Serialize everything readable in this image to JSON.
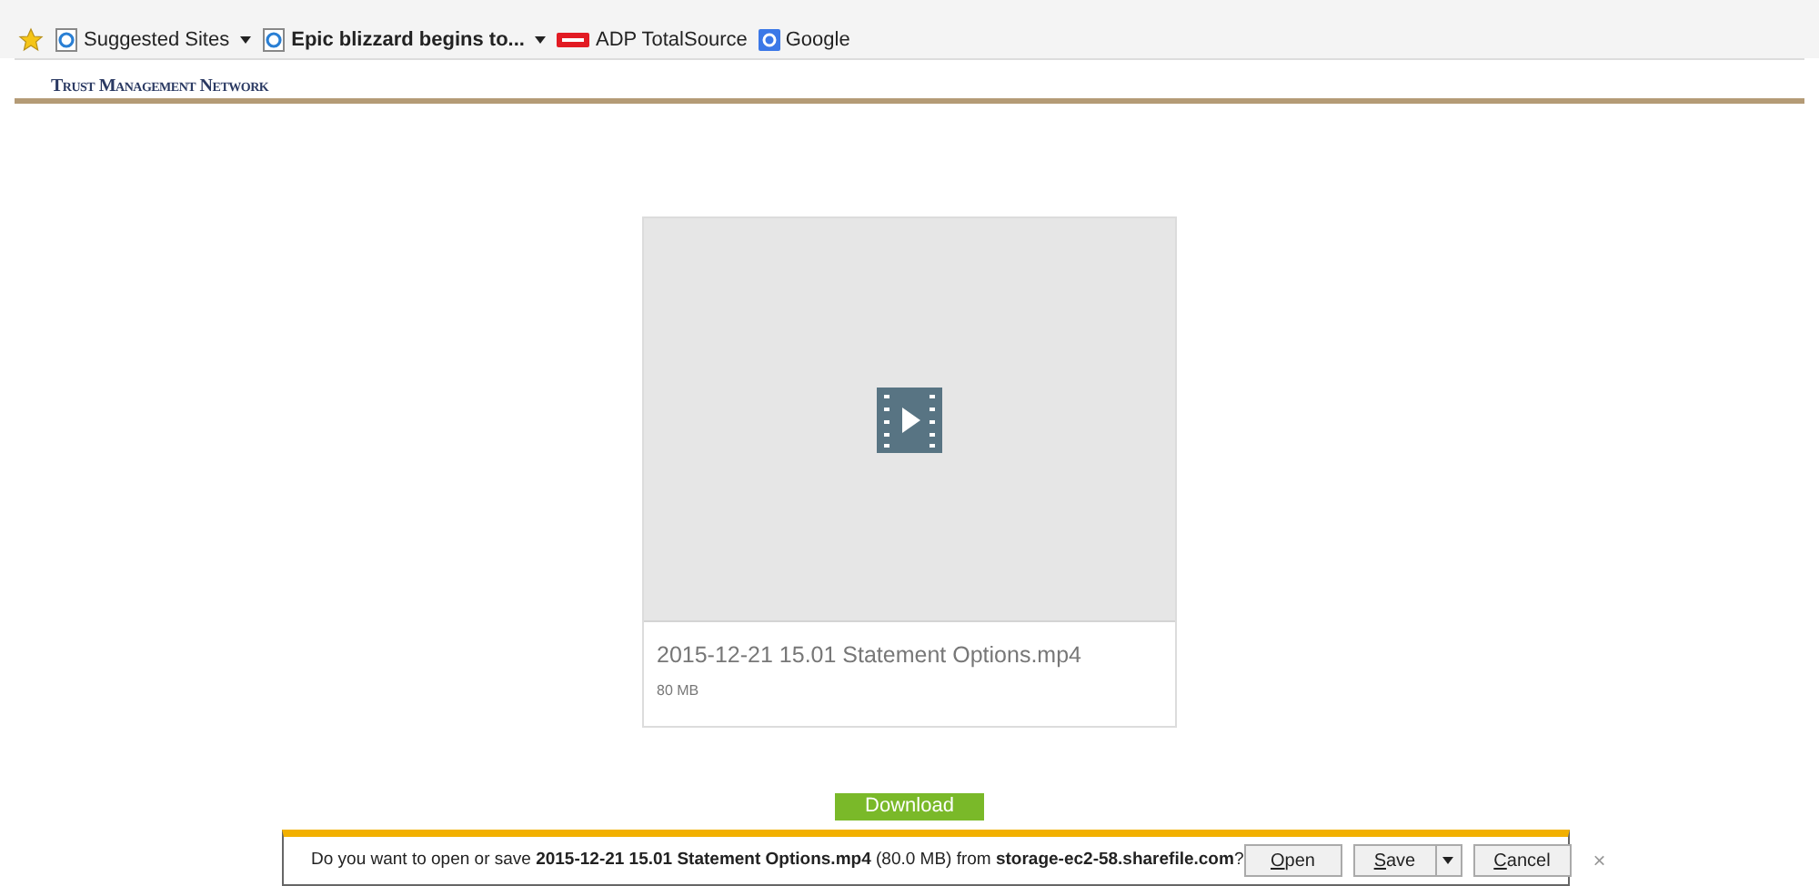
{
  "favorites_bar": {
    "items": [
      {
        "kind": "favorite",
        "label": "Suggested Sites",
        "dropdown": true,
        "bold": false
      },
      {
        "kind": "feed",
        "label": "Epic blizzard begins to...",
        "dropdown": true,
        "bold": true
      },
      {
        "kind": "adp",
        "label": "ADP TotalSource",
        "dropdown": false,
        "bold": false
      },
      {
        "kind": "google",
        "label": "Google",
        "dropdown": false,
        "bold": false
      }
    ]
  },
  "header": {
    "title": "Trust Management Network"
  },
  "file_card": {
    "name": "2015-12-21 15.01 Statement Options.mp4",
    "size": "80 MB"
  },
  "download_button": "Download",
  "notification_bar": {
    "message": "Do you want to open or save **2015-12-21 15.01 Statement Options.mp4** (80.0 MB) from **storage-ec2-58.sharefile.com**?",
    "buttons": [
      {
        "label": "Open",
        "split": false
      },
      {
        "label": "Save",
        "split": true
      },
      {
        "label": "Cancel",
        "split": false
      }
    ],
    "close": "×"
  }
}
